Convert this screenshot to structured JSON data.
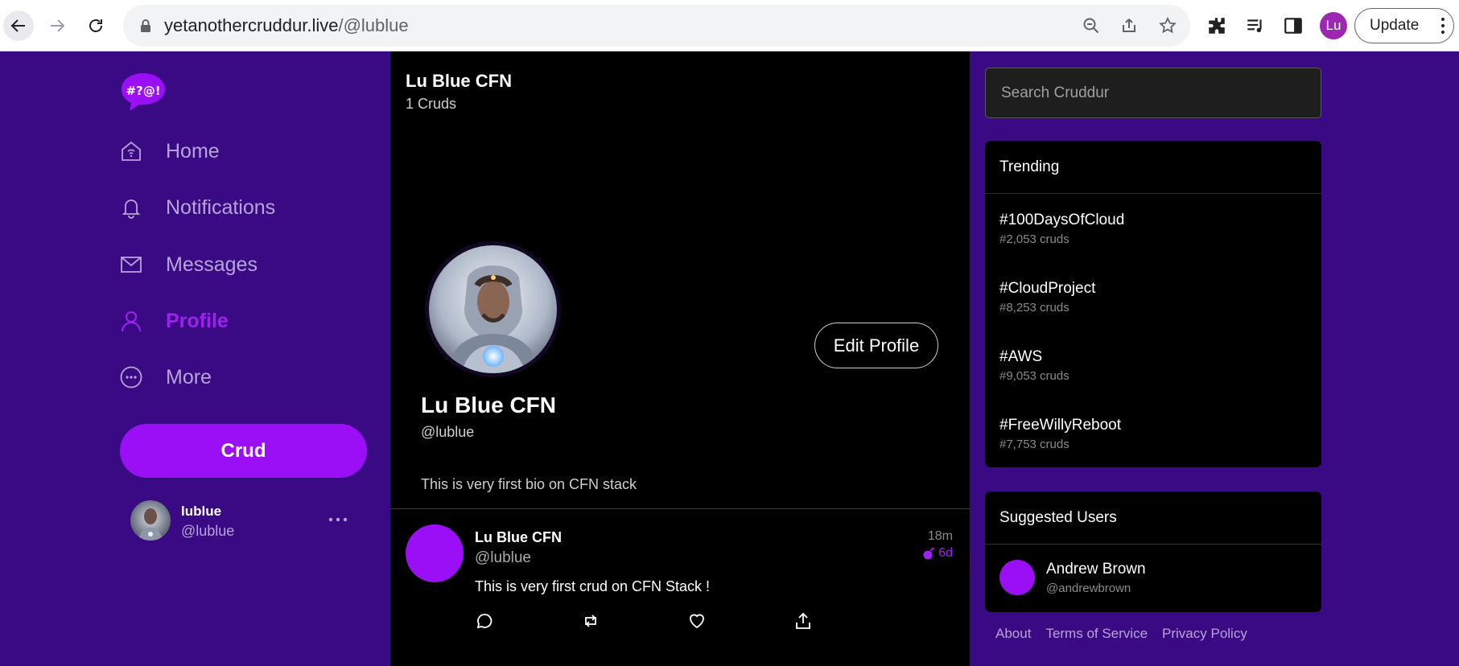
{
  "browser": {
    "url_domain": "yetanothercruddur.live",
    "url_path": "/@lublue",
    "avatar_initials": "Lu",
    "update_label": "Update"
  },
  "nav": {
    "items": [
      {
        "label": "Home",
        "icon": "home-icon"
      },
      {
        "label": "Notifications",
        "icon": "bell-icon"
      },
      {
        "label": "Messages",
        "icon": "mail-icon"
      },
      {
        "label": "Profile",
        "icon": "user-icon",
        "active": true
      },
      {
        "label": "More",
        "icon": "more-circle-icon"
      }
    ],
    "crud_button": "Crud",
    "current_user": {
      "display_name": "lublue",
      "handle": "@lublue"
    }
  },
  "profile_header": {
    "name": "Lu Blue CFN",
    "count": "1 Cruds"
  },
  "profile": {
    "name": "Lu Blue CFN",
    "handle": "@lublue",
    "bio": "This is very first bio on CFN stack",
    "edit_label": "Edit Profile"
  },
  "posts": [
    {
      "display_name": "Lu Blue CFN",
      "handle": "@lublue",
      "message": "This is very first crud on CFN Stack !",
      "time": "18m",
      "expires": "6d"
    }
  ],
  "search": {
    "placeholder": "Search Cruddur"
  },
  "trending": {
    "title": "Trending",
    "items": [
      {
        "tag": "#100DaysOfCloud",
        "count": "#2,053 cruds"
      },
      {
        "tag": "#CloudProject",
        "count": "#8,253 cruds"
      },
      {
        "tag": "#AWS",
        "count": "#9,053 cruds"
      },
      {
        "tag": "#FreeWillyReboot",
        "count": "#7,753 cruds"
      }
    ]
  },
  "suggested": {
    "title": "Suggested Users",
    "users": [
      {
        "name": "Andrew Brown",
        "handle": "@andrewbrown"
      }
    ]
  },
  "footer": {
    "about": "About",
    "terms": "Terms of Service",
    "privacy": "Privacy Policy"
  },
  "colors": {
    "accent": "#9a0ff5",
    "background": "#3a0a84",
    "panel": "#000000"
  }
}
